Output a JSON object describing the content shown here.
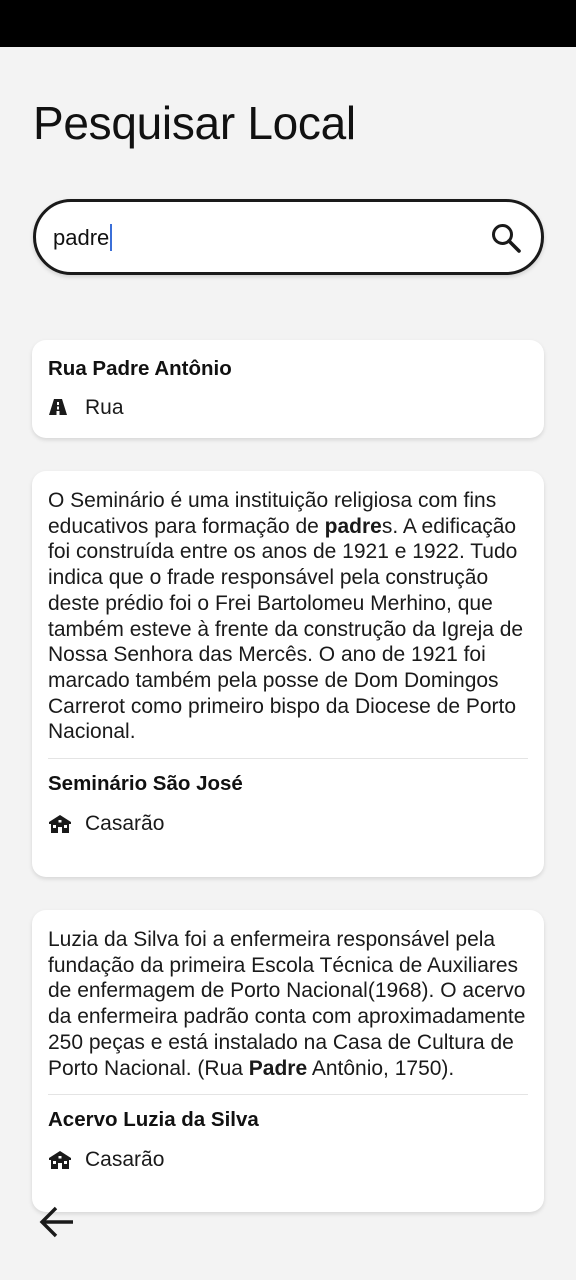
{
  "page": {
    "title": "Pesquisar Local"
  },
  "search": {
    "value": "padre"
  },
  "results": [
    {
      "title": "Rua Padre Antônio",
      "type": "Rua",
      "type_icon": "road-icon"
    },
    {
      "description_parts": [
        "O Seminário é uma instituição religiosa com fins educativos para formação de ",
        "padre",
        "s. A edificação foi construída entre os anos de 1921 e 1922. Tudo indica que o frade responsável pela construção deste prédio foi o Frei Bartolomeu Merhino, que também esteve à frente da construção da Igreja de Nossa Senhora das Mercês. O ano de 1921 foi marcado também pela posse de Dom Domingos Carrerot como primeiro bispo da Diocese de Porto Nacional."
      ],
      "title": "Seminário São José",
      "type": "Casarão",
      "type_icon": "house-icon"
    },
    {
      "description_parts": [
        "Luzia da Silva foi a enfermeira responsável pela fundação da primeira Escola Técnica de Auxiliares de enfermagem de Porto Nacional(1968). O acervo da enfermeira padrão conta com aproximadamente 250 peças e está instalado na Casa de Cultura de Porto Nacional. (Rua ",
        "Padre",
        " Antônio, 1750)."
      ],
      "title": "Acervo Luzia da Silva",
      "type": "Casarão",
      "type_icon": "house-icon"
    }
  ],
  "navigation": {
    "back_icon": "arrow-left-icon"
  },
  "colors": {
    "background": "#f3f3f3",
    "card": "#ffffff",
    "caret": "#3b6fd8",
    "status_bar": "#000000"
  }
}
